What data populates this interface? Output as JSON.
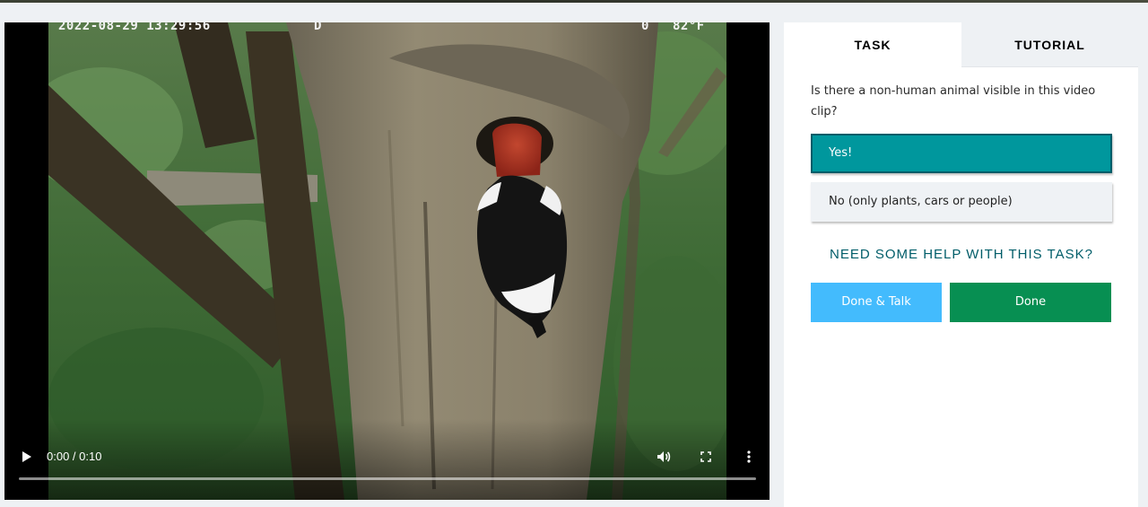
{
  "video": {
    "overlay": {
      "timestamp": "2022-08-29 13:29:56",
      "mode": "D",
      "moon": "0",
      "temperature": "82°F"
    },
    "time_display": "0:00 / 0:10",
    "progress": 0,
    "icons": {
      "play": "play-icon",
      "volume": "volume-icon",
      "fullscreen": "fullscreen-icon",
      "more": "more-options-icon"
    }
  },
  "tabs": [
    {
      "label": "TASK",
      "active": true
    },
    {
      "label": "TUTORIAL",
      "active": false
    }
  ],
  "task": {
    "question": "Is there a non-human animal visible in this video clip?",
    "answers": [
      {
        "label": "Yes!",
        "selected": true
      },
      {
        "label": "No (only plants, cars or people)",
        "selected": false
      }
    ],
    "help_link": "NEED SOME HELP WITH THIS TASK?",
    "done_talk_label": "Done & Talk",
    "done_label": "Done"
  },
  "colors": {
    "selected_answer": "#00979d",
    "help_link": "#005d69",
    "done_talk": "#43bbfd",
    "done": "#078f52"
  }
}
